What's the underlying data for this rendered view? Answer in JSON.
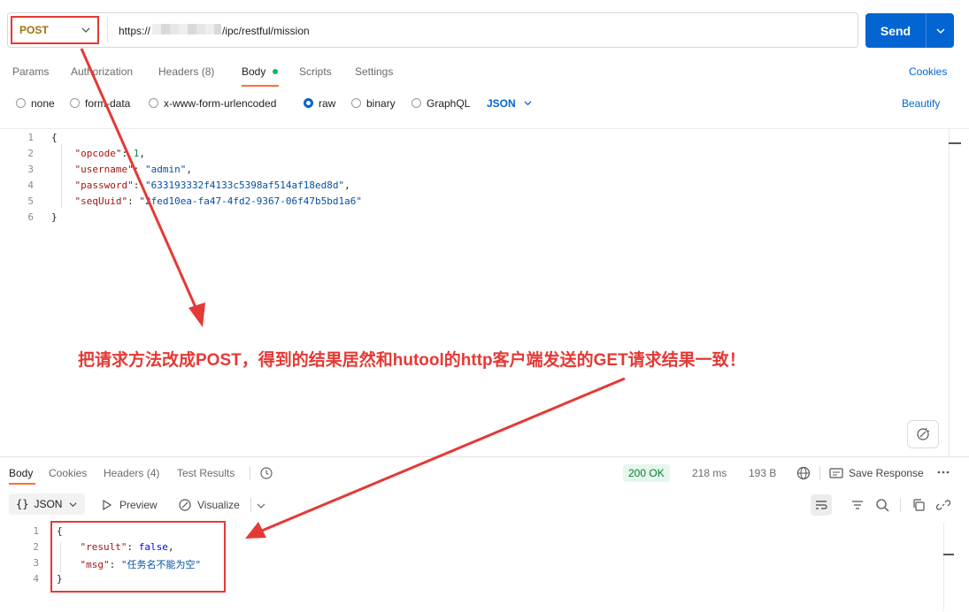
{
  "request": {
    "method": "POST",
    "url_prefix": "https://",
    "url_suffix": "/ipc/restful/mission",
    "send_label": "Send"
  },
  "request_tabs": [
    {
      "label": "Params"
    },
    {
      "label": "Authorization"
    },
    {
      "label": "Headers (8)"
    },
    {
      "label": "Body"
    },
    {
      "label": "Scripts"
    },
    {
      "label": "Settings"
    }
  ],
  "cookies_label": "Cookies",
  "body_types": [
    {
      "label": "none"
    },
    {
      "label": "form-data"
    },
    {
      "label": "x-www-form-urlencoded"
    },
    {
      "label": "raw",
      "selected": true
    },
    {
      "label": "binary"
    },
    {
      "label": "GraphQL"
    }
  ],
  "body_format": "JSON",
  "beautify_label": "Beautify",
  "request_body_lines": [
    {
      "n": "1",
      "text": "{"
    },
    {
      "n": "2",
      "key": "opcode",
      "val": "1",
      "vtype": "n"
    },
    {
      "n": "3",
      "key": "username",
      "val": "\"admin\"",
      "vtype": "s"
    },
    {
      "n": "4",
      "key": "password",
      "val": "\"633193332f4133c5398af514af18ed8d\"",
      "vtype": "s"
    },
    {
      "n": "5",
      "key": "seqUuid",
      "val": "\"2fed10ea-fa47-4fd2-9367-06f47b5bd1a6\"",
      "vtype": "s",
      "last": true
    },
    {
      "n": "6",
      "text": "}"
    }
  ],
  "annotation": "把请求方法改成POST，得到的结果居然和hutool的http客户端发送的GET请求结果一致！",
  "response_tabs": [
    {
      "label": "Body"
    },
    {
      "label": "Cookies"
    },
    {
      "label": "Headers (4)"
    },
    {
      "label": "Test Results"
    }
  ],
  "response_status": "200 OK",
  "response_time": "218 ms",
  "response_size": "193 B",
  "save_response_label": "Save Response",
  "response_format": "JSON",
  "preview_label": "Preview",
  "visualize_label": "Visualize",
  "response_body_lines": [
    {
      "n": "1",
      "text": "{"
    },
    {
      "n": "2",
      "key": "result",
      "val": "false",
      "vtype": "b"
    },
    {
      "n": "3",
      "key": "msg",
      "val": "\"任务名不能为空\"",
      "vtype": "s",
      "last": true
    },
    {
      "n": "4",
      "text": "}"
    }
  ],
  "colors": {
    "accent_blue": "#0265d2",
    "annotation_red": "#e53935",
    "tab_underline": "#ff6c37",
    "status_green": "#0a7a37"
  }
}
